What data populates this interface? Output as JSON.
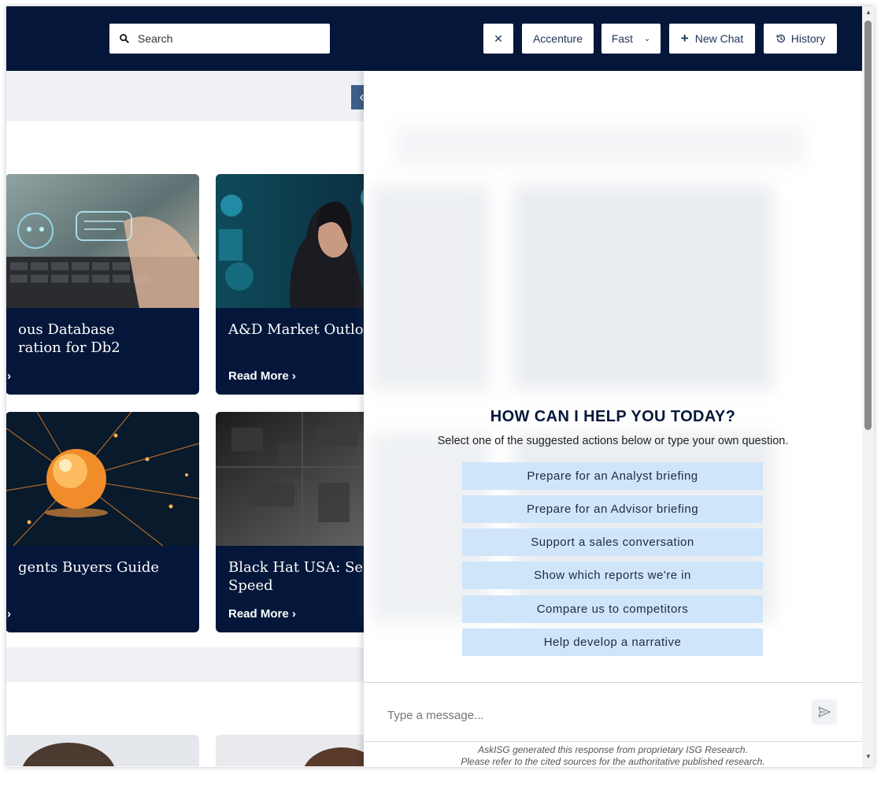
{
  "topbar": {
    "search_placeholder": "Search",
    "close_label": "✕",
    "company_label": "Accenture",
    "mode_label": "Fast",
    "new_chat_label": "New Chat",
    "history_label": "History"
  },
  "cards": [
    {
      "title": "ous Database\nration for Db2",
      "read_more": "›"
    },
    {
      "title": "A&D Market Outlook",
      "read_more": "Read More  ›"
    },
    {
      "title": "gents Buyers Guide",
      "read_more": "›"
    },
    {
      "title": "Black Hat USA: Secu\nSpeed",
      "read_more": "Read More  ›"
    }
  ],
  "collapse_icon": "«",
  "chat": {
    "greeting": "HOW CAN I HELP YOU TODAY?",
    "subtitle": "Select one of the suggested actions below or type your own question.",
    "suggestions": [
      "Prepare for an Analyst briefing",
      "Prepare for an Advisor briefing",
      "Support a sales conversation",
      "Show which reports we're in",
      "Compare us to competitors",
      "Help develop a narrative"
    ],
    "input_placeholder": "Type a message...",
    "disclaimer_line1": "AskISG generated this response from proprietary ISG Research.",
    "disclaimer_line2": "Please refer to the cited sources for the authoritative published research."
  },
  "colors": {
    "navy": "#04173a",
    "suggestion_bg": "#cfe5fa",
    "collapse_bg": "#3d5f88"
  },
  "icons": {
    "search": "search-icon",
    "close": "close-icon",
    "chevron": "chevron-down-icon",
    "plus": "plus-icon",
    "history": "history-icon",
    "collapse": "double-chevron-left-icon",
    "send": "send-icon"
  }
}
